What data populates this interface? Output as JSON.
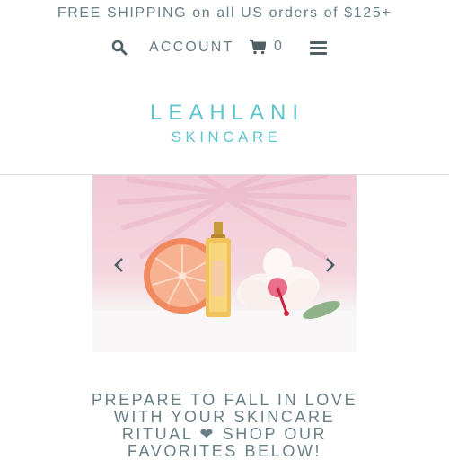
{
  "announcement": {
    "text": "FREE SHIPPING on all US orders of $125+"
  },
  "nav": {
    "search_icon": "search-icon",
    "account_label": "ACCOUNT",
    "cart_icon": "shopping-cart-icon",
    "cart_count": "0",
    "menu_icon": "hamburger-menu-icon"
  },
  "logo": {
    "brand": "LEAHLANI",
    "sub": "SKINCARE"
  },
  "slider": {
    "image_description": "product-photo-icon",
    "prev_icon": "chevron-left-icon",
    "next_icon": "chevron-right-icon"
  },
  "headline": {
    "line1": "PREPARE TO FALL IN LOVE",
    "line2": "WITH YOUR SKINCARE",
    "line3": "RITUAL ❤ SHOP OUR",
    "line4": "FAVORITES BELOW!"
  },
  "colors": {
    "brand_teal": "#5fc6cc",
    "text_slate": "#6a7e86",
    "slide_pink": "#f1c9d6"
  }
}
